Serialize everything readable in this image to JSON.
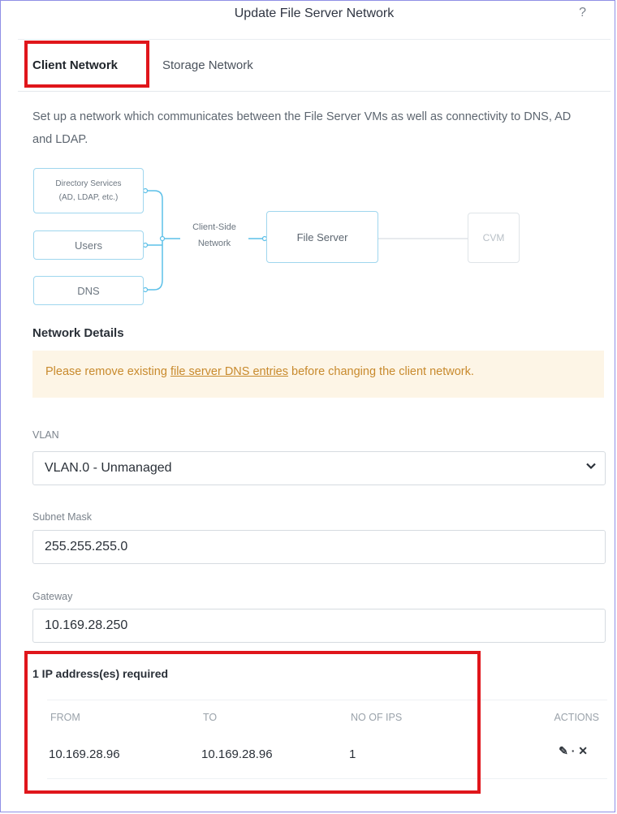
{
  "dialog": {
    "title": "Update File Server Network",
    "help_icon": "?"
  },
  "tabs": [
    {
      "label": "Client Network",
      "active": true
    },
    {
      "label": "Storage Network",
      "active": false
    }
  ],
  "description": "Set up a network which communicates between the File Server VMs as well as connectivity to DNS, AD and LDAP.",
  "diagram": {
    "directory_services_line1": "Directory Services",
    "directory_services_line2": "(AD, LDAP, etc.)",
    "users": "Users",
    "dns": "DNS",
    "network_line1": "Client-Side",
    "network_line2": "Network",
    "file_server": "File Server",
    "cvm": "CVM"
  },
  "network_details": {
    "title": "Network Details",
    "warning_before": "Please remove existing ",
    "warning_link": "file server DNS entries",
    "warning_after": " before changing the client network."
  },
  "vlan": {
    "label": "VLAN",
    "value": "VLAN.0 - Unmanaged"
  },
  "subnet": {
    "label": "Subnet Mask",
    "value": "255.255.255.0"
  },
  "gateway": {
    "label": "Gateway",
    "value": "10.169.28.250"
  },
  "ip_table": {
    "title": "1 IP address(es) required",
    "headers": [
      "FROM",
      "TO",
      "NO OF IPS",
      "ACTIONS"
    ],
    "rows": [
      {
        "from": "10.169.28.96",
        "to": "10.169.28.96",
        "count": "1",
        "edit": "✎",
        "sep": "·",
        "delete": "✕"
      }
    ]
  },
  "colors": {
    "highlight": "#e0161b",
    "diagram_line": "#5cc0e8",
    "warning_bg": "#fdf5e6",
    "warning_text": "#c88a2d"
  }
}
